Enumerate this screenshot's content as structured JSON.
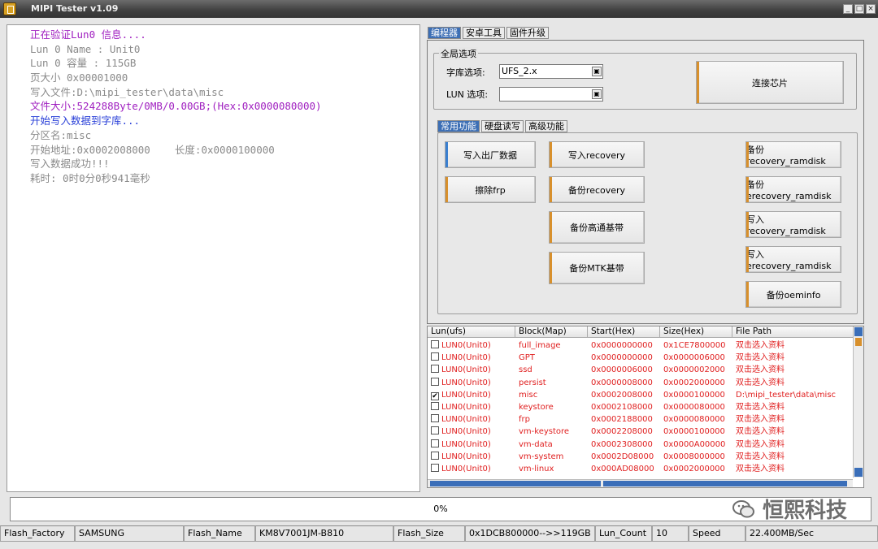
{
  "app": {
    "title": "MIPI Tester v1.09",
    "icon": "app-icon"
  },
  "window_buttons": [
    "_",
    "□",
    "×"
  ],
  "log": [
    {
      "text": "正在验证Lun0 信息....",
      "color": "#a020c0"
    },
    {
      "text": "Lun 0 Name : Unit0",
      "color": "#8a8a8a"
    },
    {
      "text": "Lun 0 容量 : 115GB",
      "color": "#8a8a8a"
    },
    {
      "text": "页大小 0x00001000",
      "color": "#8a8a8a"
    },
    {
      "text": "写入文件:D:\\mipi_tester\\data\\misc",
      "color": "#8a8a8a"
    },
    {
      "text": "文件大小:524288Byte/0MB/0.00GB;(Hex:0x0000080000)",
      "color": "#a020c0"
    },
    {
      "text": "开始写入数据到字库...",
      "color": "#2a40d8"
    },
    {
      "text": "分区名:misc",
      "color": "#8a8a8a"
    },
    {
      "text": "开始地址:0x0002008000    长度:0x0000100000",
      "color": "#8a8a8a"
    },
    {
      "text": "写入数据成功!!!",
      "color": "#8a8a8a"
    },
    {
      "text": "耗时: 0时0分0秒941毫秒",
      "color": "#8a8a8a"
    }
  ],
  "main_tabs": [
    "编程器",
    "安卓工具",
    "固件升级"
  ],
  "global_options": {
    "group_label": "全局选项",
    "library_label": "字库选项:",
    "library_value": "UFS_2.x",
    "lun_label": "LUN 选项:",
    "lun_value": "",
    "connect_button": "连接芯片"
  },
  "sub_tabs": [
    "常用功能",
    "硬盘读写",
    "高级功能"
  ],
  "functions": {
    "write_factory": "写入出厂数据",
    "erase_frp": "擦除frp",
    "write_recovery": "写入recovery",
    "backup_recovery": "备份recovery",
    "backup_qualcomm": "备份高通基带",
    "backup_mtk": "备份MTK基带",
    "backup_recovery_ramdisk": "备份recovery_ramdisk",
    "backup_erecovery_ramdisk": "备份erecovery_ramdisk",
    "write_recovery_ramdisk": "写入recovery_ramdisk",
    "write_erecovery_ramdisk": "写入erecovery_ramdisk",
    "backup_oeminfo": "备份oeminfo"
  },
  "table": {
    "columns": [
      "Lun(ufs)",
      "Block(Map)",
      "Start(Hex)",
      "Size(Hex)",
      "File Path"
    ],
    "rows": [
      {
        "checked": false,
        "lun": "LUN0(Unit0)",
        "block": "full_image",
        "start": "0x0000000000",
        "size": "0x1CE7800000",
        "path": "双击选入资料"
      },
      {
        "checked": false,
        "lun": "LUN0(Unit0)",
        "block": "GPT",
        "start": "0x0000000000",
        "size": "0x0000006000",
        "path": "双击选入资料"
      },
      {
        "checked": false,
        "lun": "LUN0(Unit0)",
        "block": "ssd",
        "start": "0x0000006000",
        "size": "0x0000002000",
        "path": "双击选入资料"
      },
      {
        "checked": false,
        "lun": "LUN0(Unit0)",
        "block": "persist",
        "start": "0x0000008000",
        "size": "0x0002000000",
        "path": "双击选入资料"
      },
      {
        "checked": true,
        "lun": "LUN0(Unit0)",
        "block": "misc",
        "start": "0x0002008000",
        "size": "0x0000100000",
        "path": "D:\\mipi_tester\\data\\misc"
      },
      {
        "checked": false,
        "lun": "LUN0(Unit0)",
        "block": "keystore",
        "start": "0x0002108000",
        "size": "0x0000080000",
        "path": "双击选入资料"
      },
      {
        "checked": false,
        "lun": "LUN0(Unit0)",
        "block": "frp",
        "start": "0x0002188000",
        "size": "0x0000080000",
        "path": "双击选入资料"
      },
      {
        "checked": false,
        "lun": "LUN0(Unit0)",
        "block": "vm-keystore",
        "start": "0x0002208000",
        "size": "0x0000100000",
        "path": "双击选入资料"
      },
      {
        "checked": false,
        "lun": "LUN0(Unit0)",
        "block": "vm-data",
        "start": "0x0002308000",
        "size": "0x0000A00000",
        "path": "双击选入资料"
      },
      {
        "checked": false,
        "lun": "LUN0(Unit0)",
        "block": "vm-system",
        "start": "0x0002D08000",
        "size": "0x0008000000",
        "path": "双击选入资料"
      },
      {
        "checked": false,
        "lun": "LUN0(Unit0)",
        "block": "vm-linux",
        "start": "0x000AD08000",
        "size": "0x0002000000",
        "path": "双击选入资料"
      }
    ]
  },
  "progress": {
    "text": "0%",
    "fraction": 0
  },
  "status_bar": {
    "flash_factory_label": "Flash_Factory",
    "flash_factory_value": "SAMSUNG",
    "flash_name_label": "Flash_Name",
    "flash_name_value": "KM8V7001JM-B810",
    "flash_size_label": "Flash_Size",
    "flash_size_value": "0x1DCB800000-->>119GB",
    "lun_count_label": "Lun_Count",
    "lun_count_value": "10",
    "speed_label": "Speed",
    "speed_value": "22.400MB/Sec"
  },
  "watermark": {
    "text": "恒熙科技",
    "icon": "wechat-logo-icon"
  },
  "colors": {
    "accent_blue": "#3a7fd0",
    "accent_orange": "#d8902c",
    "row_red": "#e02020"
  }
}
